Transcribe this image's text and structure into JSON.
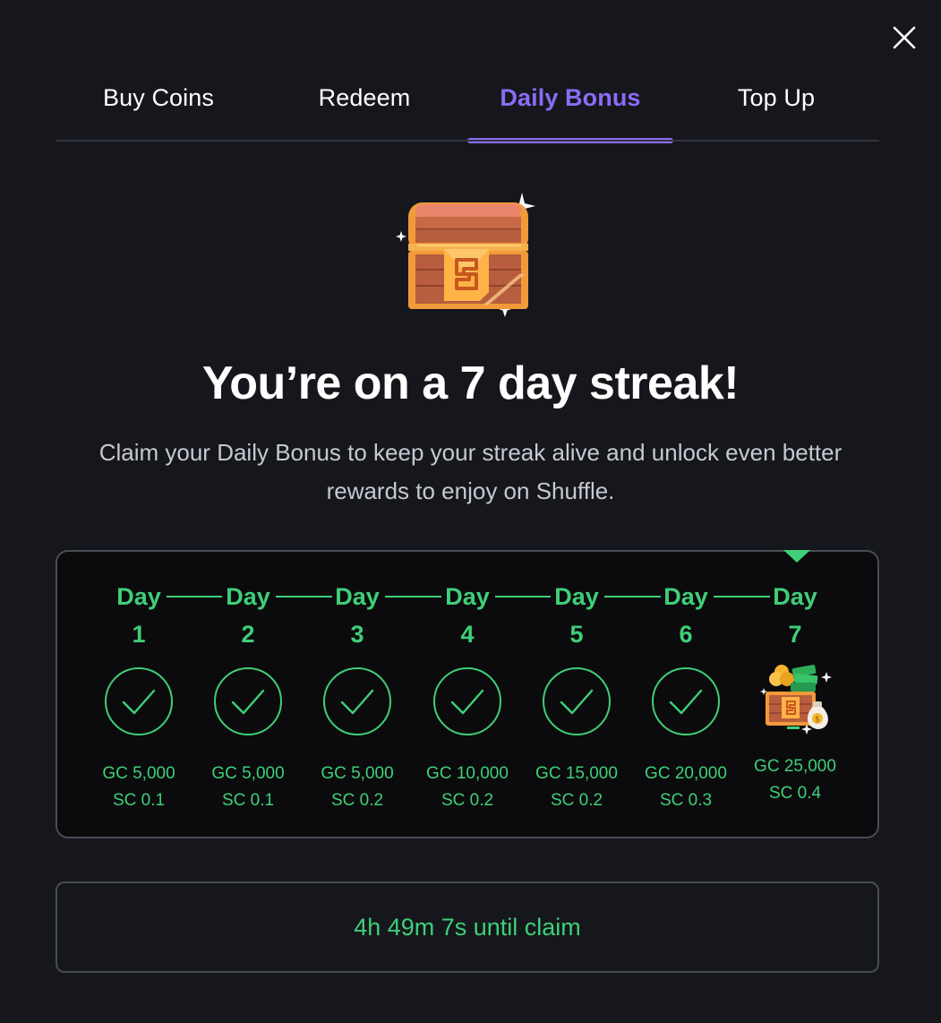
{
  "close_icon": "close-icon",
  "tabs": [
    {
      "label": "Buy Coins",
      "active": false
    },
    {
      "label": "Redeem",
      "active": false
    },
    {
      "label": "Daily Bonus",
      "active": true
    },
    {
      "label": "Top Up",
      "active": false
    }
  ],
  "hero": {
    "icon": "treasure-chest-icon",
    "headline": "You’re on a 7 day streak!",
    "subtext": "Claim your Daily Bonus to keep your streak alive and unlock even better rewards to enjoy on Shuffle."
  },
  "streak": {
    "days": [
      {
        "word": "Day",
        "number": "1",
        "status": "claimed",
        "gc": "GC 5,000",
        "sc": "SC 0.1"
      },
      {
        "word": "Day",
        "number": "2",
        "status": "claimed",
        "gc": "GC 5,000",
        "sc": "SC 0.1"
      },
      {
        "word": "Day",
        "number": "3",
        "status": "claimed",
        "gc": "GC 5,000",
        "sc": "SC 0.2"
      },
      {
        "word": "Day",
        "number": "4",
        "status": "claimed",
        "gc": "GC 10,000",
        "sc": "SC 0.2"
      },
      {
        "word": "Day",
        "number": "5",
        "status": "claimed",
        "gc": "GC 15,000",
        "sc": "SC 0.2"
      },
      {
        "word": "Day",
        "number": "6",
        "status": "claimed",
        "gc": "GC 20,000",
        "sc": "SC 0.3"
      },
      {
        "word": "Day",
        "number": "7",
        "status": "current",
        "gc": "GC 25,000",
        "sc": "SC 0.4"
      }
    ],
    "current_day": 7
  },
  "claim": {
    "text": "4h 49m 7s until claim"
  },
  "colors": {
    "background": "#16171c",
    "accent_purple": "#8b6cf6",
    "streak_green": "#3fcf78",
    "panel": "#0b0b0d",
    "border": "#4a4c55"
  }
}
